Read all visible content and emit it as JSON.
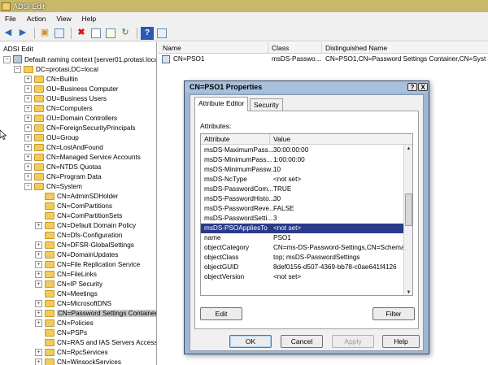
{
  "window": {
    "title": "ADSI Edit"
  },
  "menu": [
    "File",
    "Action",
    "View",
    "Help"
  ],
  "toolbar": {
    "icons": [
      "back-arrow-icon",
      "forward-arrow-icon",
      "up-folder-icon",
      "show-hide-tree-icon",
      "delete-icon",
      "properties-icon",
      "export-list-icon",
      "refresh-icon",
      "help-icon",
      "show-hide-action-pane-icon"
    ]
  },
  "tree": {
    "root": "ADSI Edit",
    "items": [
      {
        "label": "Default naming context [server01.protasi.local]",
        "indent": 0,
        "expander": "−",
        "type": "server"
      },
      {
        "label": "DC=protasi,DC=local",
        "indent": 1,
        "expander": "−",
        "type": "folder"
      },
      {
        "label": "CN=Builtin",
        "indent": 2,
        "expander": "+",
        "type": "folder"
      },
      {
        "label": "OU=Business Computer",
        "indent": 2,
        "expander": "+",
        "type": "folder"
      },
      {
        "label": "OU=Business Users",
        "indent": 2,
        "expander": "+",
        "type": "folder"
      },
      {
        "label": "CN=Computers",
        "indent": 2,
        "expander": "+",
        "type": "folder"
      },
      {
        "label": "OU=Domain Controllers",
        "indent": 2,
        "expander": "+",
        "type": "folder"
      },
      {
        "label": "CN=ForeignSecurityPrincipals",
        "indent": 2,
        "expander": "+",
        "type": "folder"
      },
      {
        "label": "OU=Group",
        "indent": 2,
        "expander": "+",
        "type": "folder"
      },
      {
        "label": "CN=LostAndFound",
        "indent": 2,
        "expander": "+",
        "type": "folder"
      },
      {
        "label": "CN=Managed Service Accounts",
        "indent": 2,
        "expander": "+",
        "type": "folder"
      },
      {
        "label": "CN=NTDS Quotas",
        "indent": 2,
        "expander": "+",
        "type": "folder"
      },
      {
        "label": "CN=Program Data",
        "indent": 2,
        "expander": "+",
        "type": "folder"
      },
      {
        "label": "CN=System",
        "indent": 2,
        "expander": "−",
        "type": "folder"
      },
      {
        "label": "CN=AdminSDHolder",
        "indent": 3,
        "expander": "",
        "type": "folder"
      },
      {
        "label": "CN=ComPartitions",
        "indent": 3,
        "expander": "",
        "type": "folder"
      },
      {
        "label": "CN=ComPartitionSets",
        "indent": 3,
        "expander": "",
        "type": "folder"
      },
      {
        "label": "CN=Default Domain Policy",
        "indent": 3,
        "expander": "+",
        "type": "folder"
      },
      {
        "label": "CN=Dfs-Configuration",
        "indent": 3,
        "expander": "",
        "type": "folder"
      },
      {
        "label": "CN=DFSR-GlobalSettings",
        "indent": 3,
        "expander": "+",
        "type": "folder"
      },
      {
        "label": "CN=DomainUpdates",
        "indent": 3,
        "expander": "+",
        "type": "folder"
      },
      {
        "label": "CN=File Replication Service",
        "indent": 3,
        "expander": "+",
        "type": "folder"
      },
      {
        "label": "CN=FileLinks",
        "indent": 3,
        "expander": "+",
        "type": "folder"
      },
      {
        "label": "CN=IP Security",
        "indent": 3,
        "expander": "+",
        "type": "folder"
      },
      {
        "label": "CN=Meetings",
        "indent": 3,
        "expander": "",
        "type": "folder"
      },
      {
        "label": "CN=MicrosoftDNS",
        "indent": 3,
        "expander": "+",
        "type": "folder"
      },
      {
        "label": "CN=Password Settings Container",
        "indent": 3,
        "expander": "+",
        "type": "folder",
        "selected": true
      },
      {
        "label": "CN=Policies",
        "indent": 3,
        "expander": "+",
        "type": "folder"
      },
      {
        "label": "CN=PSPs",
        "indent": 3,
        "expander": "",
        "type": "folder"
      },
      {
        "label": "CN=RAS and IAS Servers Access Che",
        "indent": 3,
        "expander": "",
        "type": "folder"
      },
      {
        "label": "CN=RpcServices",
        "indent": 3,
        "expander": "+",
        "type": "folder"
      },
      {
        "label": "CN=WinsockServices",
        "indent": 3,
        "expander": "+",
        "type": "folder"
      }
    ]
  },
  "list": {
    "columns": [
      "Name",
      "Class",
      "Distinguished Name"
    ],
    "rows": [
      {
        "name": "CN=PSO1",
        "class": "msDS-Passwo...",
        "dn": "CN=PSO1,CN=Password Settings Container,CN=Syst"
      }
    ]
  },
  "dialog": {
    "title": "CN=PSO1 Properties",
    "title_buttons": [
      "?",
      "X"
    ],
    "tabs": [
      "Attribute Editor",
      "Security"
    ],
    "attributes_label": "Attributes:",
    "grid_columns": [
      "Attribute",
      "Value"
    ],
    "rows": [
      {
        "attribute": "msDS-MaximumPass...",
        "value": "30:00:00:00"
      },
      {
        "attribute": "msDS-MinimumPass...",
        "value": "1:00:00:00"
      },
      {
        "attribute": "msDS-MinimumPassw...",
        "value": "10"
      },
      {
        "attribute": "msDS-NcType",
        "value": "<not set>"
      },
      {
        "attribute": "msDS-PasswordCom...",
        "value": "TRUE"
      },
      {
        "attribute": "msDS-PasswordHisto...",
        "value": "30"
      },
      {
        "attribute": "msDS-PasswordReve...",
        "value": "FALSE"
      },
      {
        "attribute": "msDS-PasswordSetti...",
        "value": "3"
      },
      {
        "attribute": "msDS-PSOAppliesTo",
        "value": "<not set>",
        "selected": true
      },
      {
        "attribute": "name",
        "value": "PSO1"
      },
      {
        "attribute": "objectCategory",
        "value": "CN=ms-DS-Password-Settings,CN=Schema,C"
      },
      {
        "attribute": "objectClass",
        "value": "top; msDS-PasswordSettings"
      },
      {
        "attribute": "objectGUID",
        "value": "8def0156-d507-4369-bb78-c0ae641f4126"
      },
      {
        "attribute": "objectVersion",
        "value": "<not set>"
      }
    ],
    "edit_label": "Edit",
    "filter_label": "Filter",
    "ok_label": "OK",
    "cancel_label": "Cancel",
    "apply_label": "Apply",
    "help_label": "Help"
  }
}
